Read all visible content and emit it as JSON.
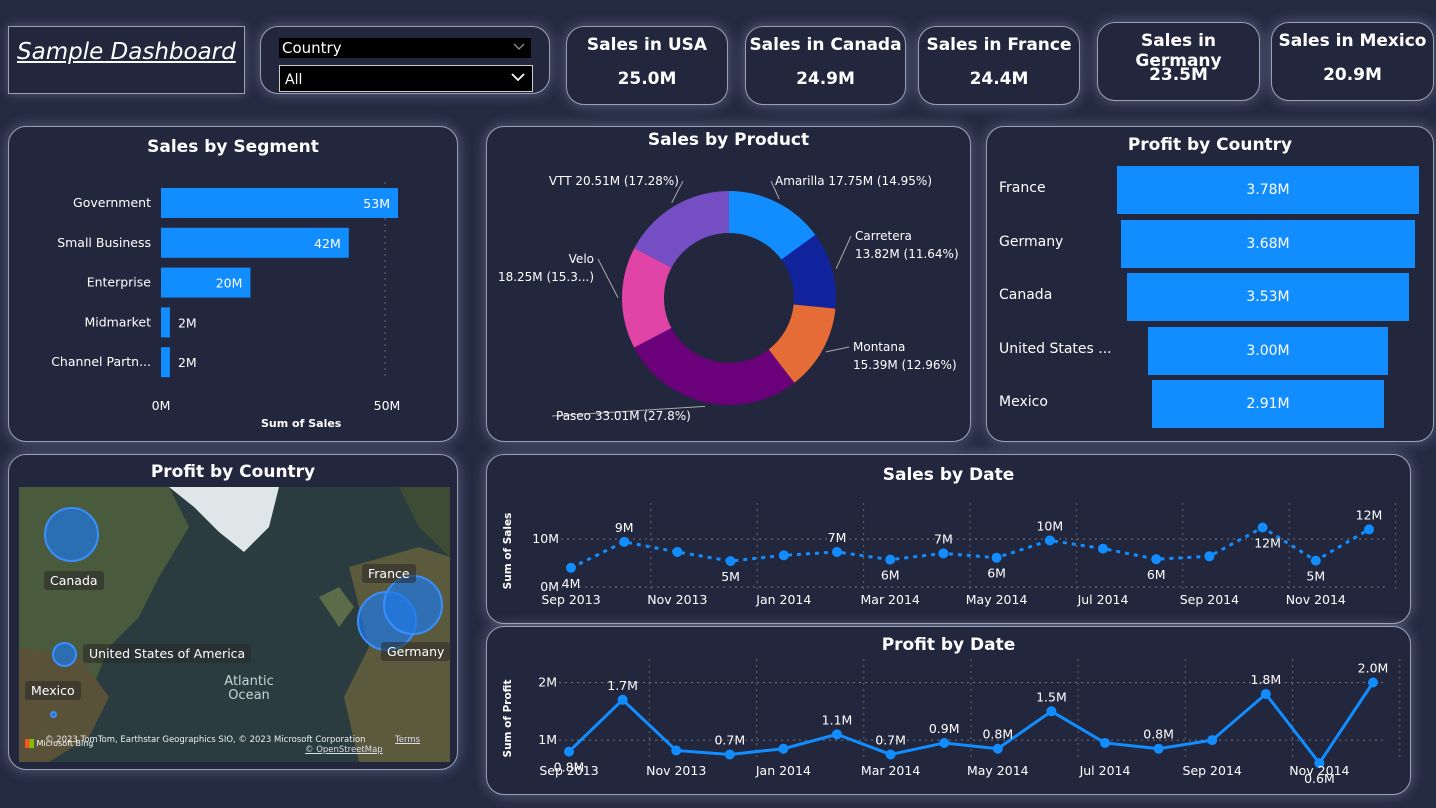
{
  "dashboard_title": "Sample Dashboard",
  "slicer": {
    "header": "Country",
    "value": "All"
  },
  "kpis": [
    {
      "label": "Sales in USA",
      "value": "25.0M"
    },
    {
      "label": "Sales in Canada",
      "value": "24.9M"
    },
    {
      "label": "Sales in France",
      "value": "24.4M"
    },
    {
      "label": "Sales in Germany",
      "value": "23.5M"
    },
    {
      "label": "Sales in Mexico",
      "value": "20.9M"
    }
  ],
  "colors": {
    "accent": "#118dff",
    "background": "#252a43",
    "card": "#22273d"
  },
  "chart_data": [
    {
      "type": "bar",
      "title": "Sales by Segment",
      "xlabel": "Sum of Sales",
      "categories": [
        "Government",
        "Small Business",
        "Enterprise",
        "Midmarket",
        "Channel Partn..."
      ],
      "values": [
        53,
        42,
        20,
        2,
        2
      ],
      "data_labels": [
        "53M",
        "42M",
        "20M",
        "2M",
        "2M"
      ],
      "xticks": [
        "0M",
        "50M"
      ],
      "xlim": [
        0,
        53
      ]
    },
    {
      "type": "pie",
      "title": "Sales by Product",
      "slices": [
        {
          "name": "Amarilla",
          "value": 17.75,
          "label": "Amarilla 17.75M (14.95%)",
          "color": "#118dff"
        },
        {
          "name": "Carretera",
          "value": 13.82,
          "label": "Carretera 13.82M (11.64%)",
          "color": "#12239e"
        },
        {
          "name": "Montana",
          "value": 15.39,
          "label": "Montana 15.39M (12.96%)",
          "color": "#e66c37"
        },
        {
          "name": "Paseo",
          "value": 33.01,
          "label": "Paseo 33.01M (27.8%)",
          "color": "#6b007b"
        },
        {
          "name": "Velo",
          "value": 18.25,
          "label": "Velo 18.25M (15.3...)",
          "color": "#e044a7"
        },
        {
          "name": "VTT",
          "value": 20.51,
          "label": "VTT 20.51M (17.28%)",
          "color": "#744ec2"
        }
      ]
    },
    {
      "type": "bar",
      "title": "Profit by Country",
      "categories": [
        "France",
        "Germany",
        "Canada",
        "United States ...",
        "Mexico"
      ],
      "values": [
        3.78,
        3.68,
        3.53,
        3.0,
        2.91
      ],
      "data_labels": [
        "3.78M",
        "3.68M",
        "3.53M",
        "3.00M",
        "2.91M"
      ]
    },
    {
      "type": "line",
      "title": "Sales by Date",
      "ylabel": "Sum of Sales",
      "yticks": [
        "0M",
        "10M"
      ],
      "ylim": [
        0,
        15
      ],
      "x": [
        "Sep 2013",
        "Oct 2013",
        "Nov 2013",
        "Dec 2013",
        "Jan 2014",
        "Feb 2014",
        "Mar 2014",
        "Apr 2014",
        "May 2014",
        "Jun 2014",
        "Jul 2014",
        "Aug 2014",
        "Sep 2014",
        "Oct 2014",
        "Nov 2014",
        "Dec 2014"
      ],
      "xticks": [
        "Sep 2013",
        "Nov 2013",
        "Jan 2014",
        "Mar 2014",
        "May 2014",
        "Jul 2014",
        "Sep 2014",
        "Nov 2014"
      ],
      "values": [
        4.0,
        9.4,
        7.3,
        5.4,
        6.6,
        7.3,
        5.7,
        7.0,
        6.1,
        9.7,
        8.0,
        5.8,
        6.4,
        12.4,
        5.5,
        12.0
      ],
      "data_labels": [
        "4M",
        "9M",
        "",
        "5M",
        "",
        "7M",
        "6M",
        "7M",
        "6M",
        "10M",
        "",
        "6M",
        "",
        "12M",
        "5M",
        "12M"
      ],
      "line_style": "dotted"
    },
    {
      "type": "line",
      "title": "Profit by Date",
      "ylabel": "Sum of Profit",
      "yticks": [
        "1M",
        "2M"
      ],
      "ylim": [
        0.55,
        2.2
      ],
      "x": [
        "Sep 2013",
        "Oct 2013",
        "Nov 2013",
        "Dec 2013",
        "Jan 2014",
        "Feb 2014",
        "Mar 2014",
        "Apr 2014",
        "May 2014",
        "Jun 2014",
        "Jul 2014",
        "Aug 2014",
        "Sep 2014",
        "Oct 2014",
        "Nov 2014",
        "Dec 2014"
      ],
      "xticks": [
        "Sep 2013",
        "Nov 2013",
        "Jan 2014",
        "Mar 2014",
        "May 2014",
        "Jul 2014",
        "Sep 2014",
        "Nov 2014"
      ],
      "values": [
        0.8,
        1.7,
        0.82,
        0.75,
        0.85,
        1.1,
        0.75,
        0.95,
        0.85,
        1.5,
        0.95,
        0.85,
        1.0,
        1.8,
        0.6,
        2.0
      ],
      "data_labels": [
        "0.8M",
        "1.7M",
        "",
        "0.7M",
        "",
        "1.1M",
        "0.7M",
        "0.9M",
        "0.8M",
        "1.5M",
        "",
        "0.8M",
        "",
        "1.8M",
        "0.6M",
        "2.0M"
      ],
      "line_style": "solid"
    }
  ],
  "map": {
    "title": "Profit by Country",
    "labels": [
      "Canada",
      "United States of America",
      "Mexico",
      "France",
      "Germany",
      "Atlantic Ocean"
    ],
    "attribution": "© 2023 TomTom, Earthstar Geographics SIO, © 2023 Microsoft Corporation",
    "terms": "Terms",
    "osm": "© OpenStreetMap",
    "bing": "Microsoft Bing"
  }
}
